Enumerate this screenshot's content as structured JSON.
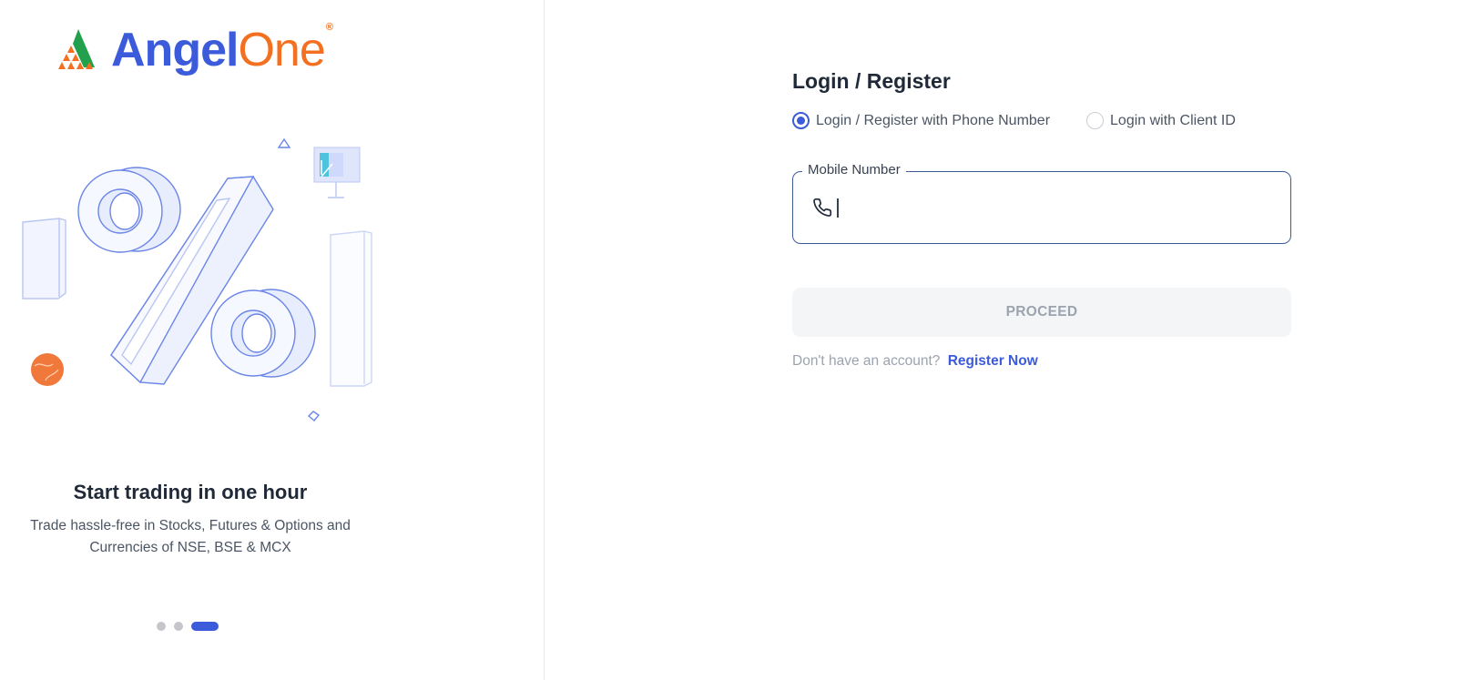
{
  "brand": {
    "name_part1": "Angel",
    "name_part2": "One",
    "registered_mark": "®"
  },
  "carousel": {
    "title": "Start trading in one hour",
    "description": "Trade hassle-free in Stocks, Futures & Options and Currencies of NSE, BSE & MCX",
    "slide_count": 3,
    "active_slide": 3
  },
  "login": {
    "title": "Login / Register",
    "options": [
      {
        "label": "Login / Register with Phone Number",
        "selected": true
      },
      {
        "label": "Login with Client ID",
        "selected": false
      }
    ],
    "mobile_field": {
      "label": "Mobile Number",
      "value": "",
      "placeholder": ""
    },
    "proceed_label": "PROCEED",
    "no_account_text": "Don't have an account?",
    "register_link": "Register Now"
  },
  "colors": {
    "brand_blue": "#3b5bdb",
    "brand_orange": "#f37021",
    "disabled_button_bg": "#f4f5f7"
  }
}
